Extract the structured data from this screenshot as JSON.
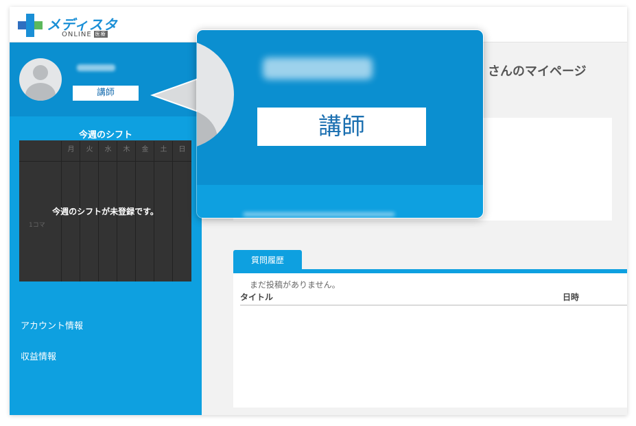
{
  "header": {
    "logo_title": "メディスタ",
    "logo_sub": "ONLINE",
    "logo_sub_badge": "医療"
  },
  "sidebar": {
    "role": "講師",
    "shift": {
      "title": "今週のシフト",
      "days": [
        "月",
        "火",
        "水",
        "木",
        "金",
        "土",
        "日"
      ],
      "empty_message": "今週のシフトが未登録です。",
      "row_label": "1コマ"
    },
    "links": [
      "アカウント情報",
      "収益情報"
    ]
  },
  "main": {
    "page_title_suffix": "さんのマイページ",
    "tab_label": "質問履歴",
    "empty_message": "まだ投稿がありません。",
    "columns": [
      "タイトル",
      "日時"
    ]
  },
  "zoom": {
    "role": "講師"
  },
  "colors": {
    "primary": "#0ea0e0",
    "primary_dark": "#0b8fd0",
    "shift_bg": "#333333"
  }
}
